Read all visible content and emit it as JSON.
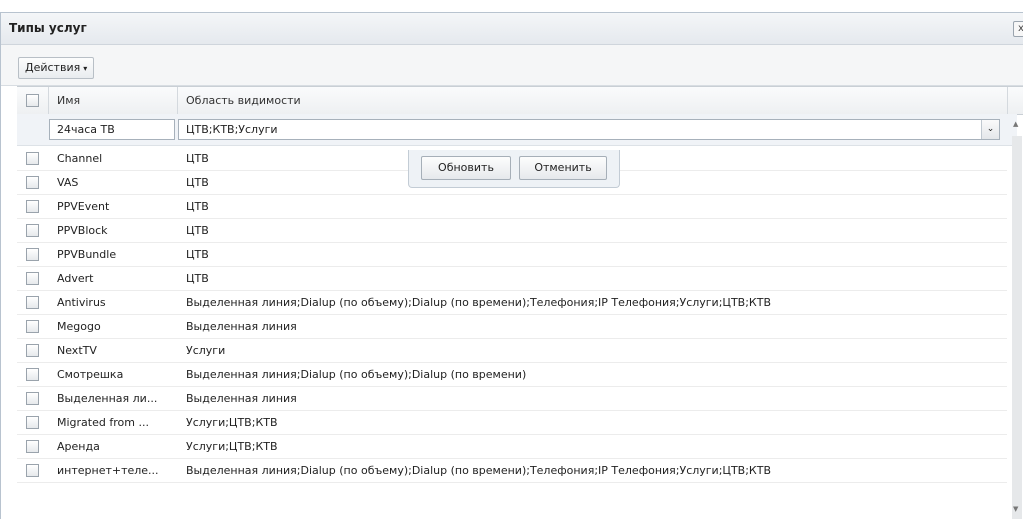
{
  "window": {
    "title": "Типы услуг",
    "close_label": "x"
  },
  "toolbar": {
    "actions_label": "Действия",
    "actions_arrow": "▾"
  },
  "grid": {
    "columns": [
      "Имя",
      "Область видимости"
    ],
    "edit_row": {
      "name": "24часа ТВ",
      "scope": "ЦТВ;КТВ;Услуги",
      "dropdown_arrow": "⌄"
    },
    "edit_buttons": {
      "update": "Обновить",
      "cancel": "Отменить"
    },
    "rows": [
      {
        "name": "Channel",
        "scope": "ЦТВ"
      },
      {
        "name": "VAS",
        "scope": "ЦТВ"
      },
      {
        "name": "PPVEvent",
        "scope": "ЦТВ"
      },
      {
        "name": "PPVBlock",
        "scope": "ЦТВ"
      },
      {
        "name": "PPVBundle",
        "scope": "ЦТВ"
      },
      {
        "name": "Advert",
        "scope": "ЦТВ"
      },
      {
        "name": "Antivirus",
        "scope": "Выделенная линия;Dialup (по объему);Dialup (по времени);Телефония;IP Телефония;Услуги;ЦТВ;КТВ"
      },
      {
        "name": "Megogo",
        "scope": "Выделенная линия"
      },
      {
        "name": "NextTV",
        "scope": "Услуги"
      },
      {
        "name": "Смотрешка",
        "scope": "Выделенная линия;Dialup (по объему);Dialup (по времени)"
      },
      {
        "name": "Выделенная ли...",
        "scope": "Выделенная линия"
      },
      {
        "name": "Migrated from ...",
        "scope": "Услуги;ЦТВ;КТВ"
      },
      {
        "name": "Аренда",
        "scope": "Услуги;ЦТВ;КТВ"
      },
      {
        "name": "интернет+теле...",
        "scope": "Выделенная линия;Dialup (по объему);Dialup (по времени);Телефония;IP Телефония;Услуги;ЦТВ;КТВ"
      }
    ]
  }
}
